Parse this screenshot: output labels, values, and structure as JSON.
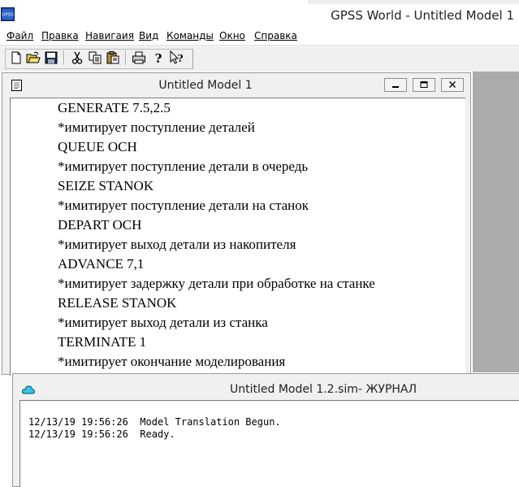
{
  "app": {
    "title": "GPSS World - Untitled Model 1",
    "icon": "gpss-app-icon"
  },
  "menu": [
    {
      "label": "Файл"
    },
    {
      "label": "Правка"
    },
    {
      "label": "Навигаия"
    },
    {
      "label": "Вид"
    },
    {
      "label": "Команды"
    },
    {
      "label": "Окно"
    },
    {
      "label": "Справка"
    }
  ],
  "toolbar": {
    "buttons": [
      "new-file-icon",
      "open-folder-icon",
      "save-disk-icon",
      "cut-scissors-icon",
      "copy-icon",
      "paste-clipboard-icon",
      "print-icon",
      "help-question-icon",
      "context-help-icon"
    ]
  },
  "model_window": {
    "title": "Untitled Model 1",
    "lines": [
      "GENERATE 7.5,2.5",
      "*имитирует поступление деталей",
      "QUEUE OCH",
      "*имитирует поступление детали в очередь",
      "SEIZE STANOK",
      "*имитирует поступление детали на станок",
      "DEPART OCH",
      "*имитирует выход детали из накопителя",
      "ADVANCE 7,1",
      "*имитирует задержку детали при обработке на станке",
      "RELEASE STANOK",
      "*имитирует выход детали из станка",
      "TERMINATE 1",
      "*имитирует окончание моделирования"
    ]
  },
  "journal_window": {
    "title": "Untitled Model 1.2.sim- ЖУРНАЛ",
    "entries": [
      "12/13/19 19:56:26  Model Translation Begun.",
      "12/13/19 19:56:26  Ready."
    ]
  },
  "colors": {
    "chrome": "#f0f0f0",
    "mdi_background": "#ababab",
    "text": "#000000"
  }
}
